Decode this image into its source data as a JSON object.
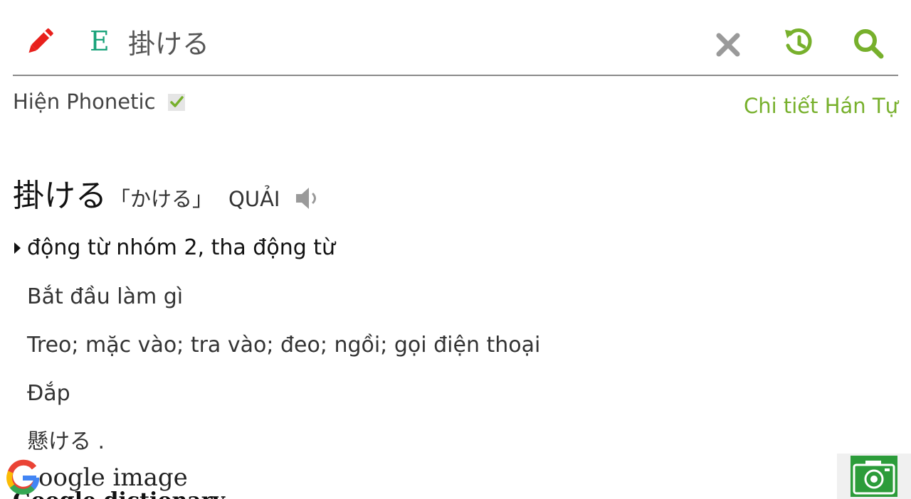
{
  "search": {
    "language_badge": "E",
    "query_value": "掛ける"
  },
  "icons": {
    "edit": "pencil-icon",
    "clear": "close-icon",
    "history": "history-icon",
    "search": "search-icon",
    "speaker": "speaker-icon",
    "camera": "camera-icon",
    "google": "google-logo-icon"
  },
  "options": {
    "phonetic_label": "Hiện Phonetic",
    "phonetic_checked": true,
    "kanji_detail_link": "Chi tiết Hán Tự"
  },
  "entry": {
    "headword": "掛ける",
    "reading": "「かける」",
    "hanviet": "QUẢI",
    "part_of_speech": "động từ nhóm 2, tha động từ",
    "meanings": [
      "Bắt đầu làm gì",
      "Treo; mặc vào; tra vào; đeo; ngồi; gọi điện thoại",
      "Đắp",
      "懸ける ."
    ]
  },
  "footer": {
    "google_image_label": "oogle image",
    "google_dictionary_label": "Google dictionary"
  },
  "colors": {
    "accent_green": "#77b02c",
    "badge_green": "#1aa37a",
    "pencil_red": "#e8201c",
    "icon_gray": "#9a9a9a"
  }
}
